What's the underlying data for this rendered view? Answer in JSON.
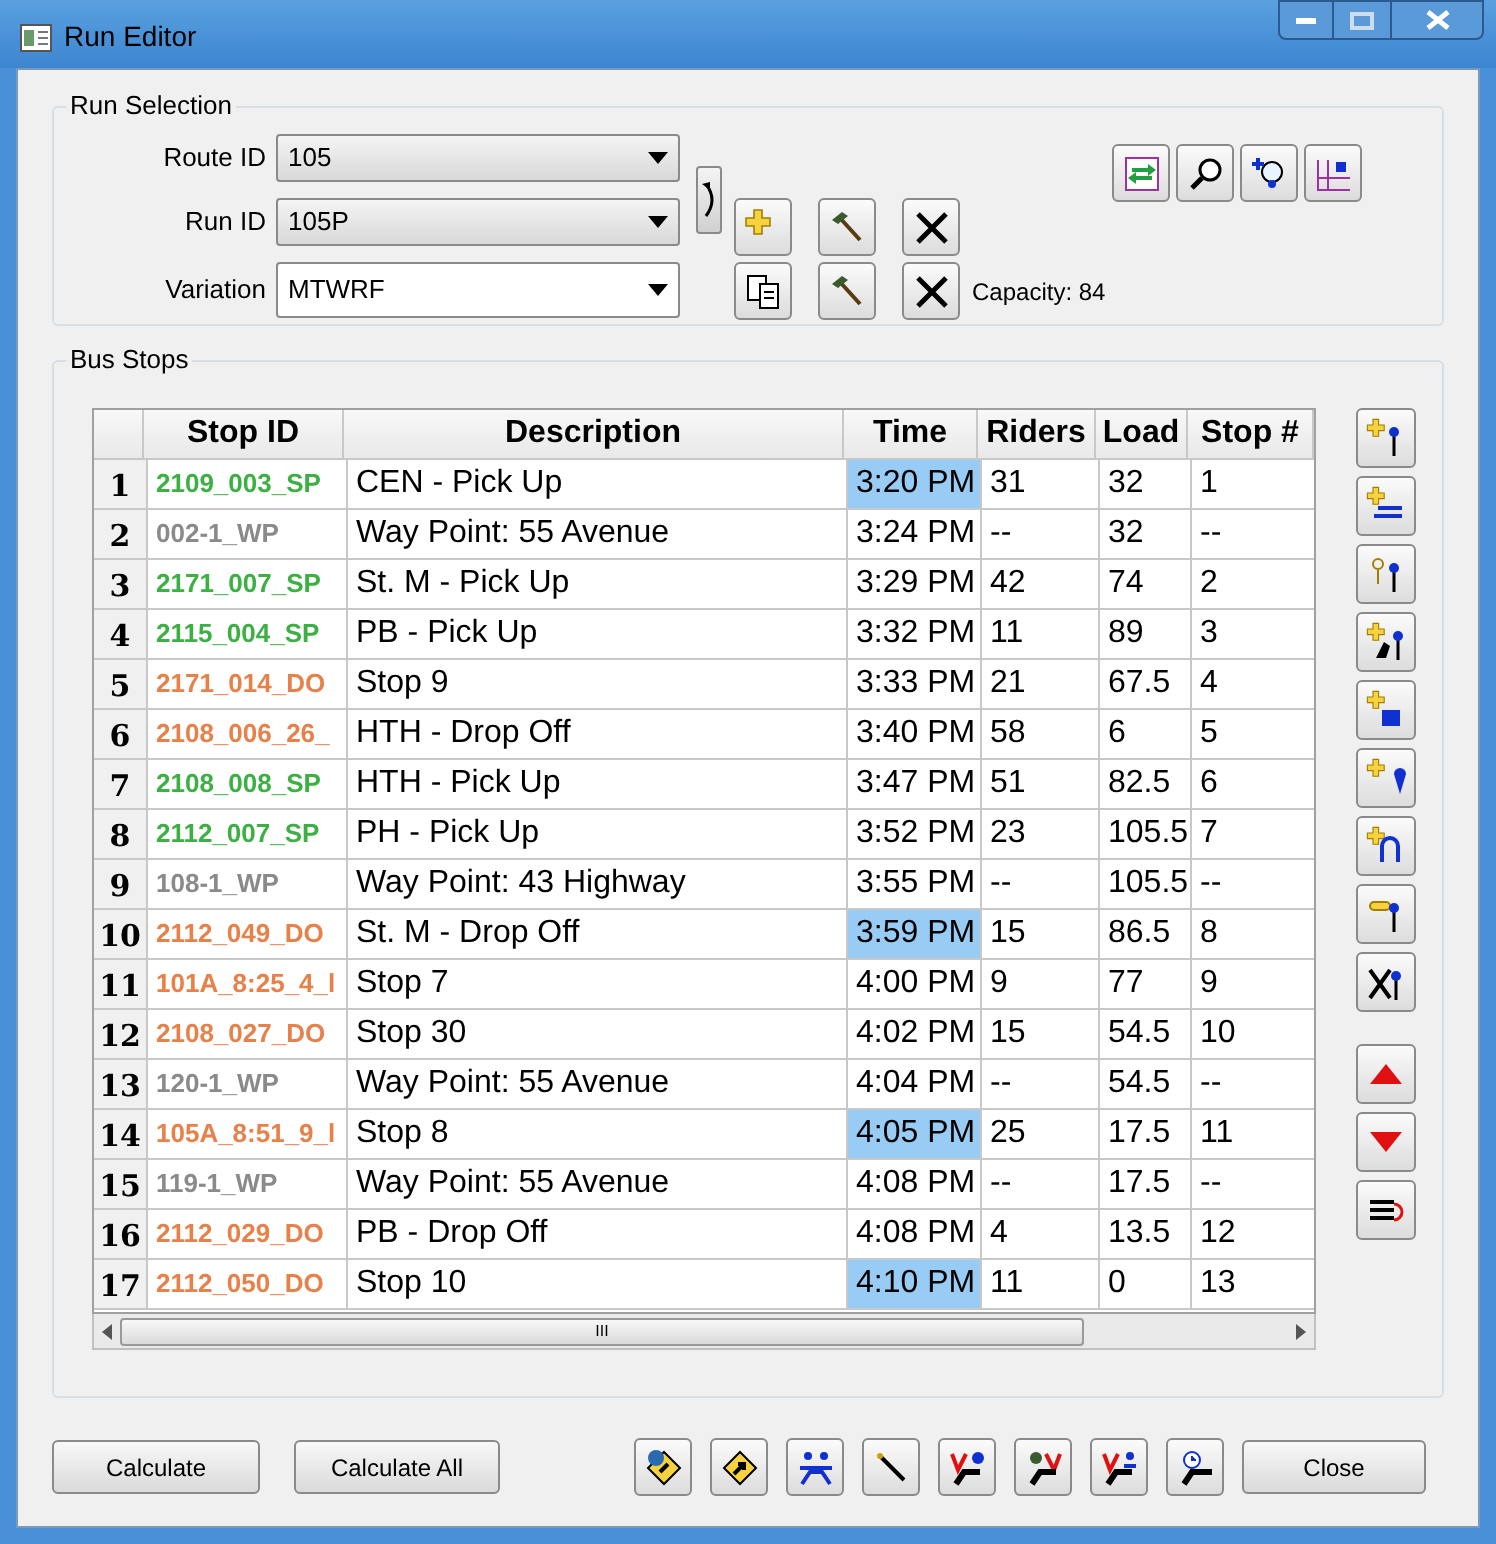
{
  "window": {
    "title": "Run Editor"
  },
  "run_selection": {
    "title": "Run Selection",
    "route_id": {
      "label": "Route ID",
      "value": "105"
    },
    "run_id": {
      "label": "Run ID",
      "value": "105P"
    },
    "variation": {
      "label": "Variation",
      "value": "MTWRF"
    },
    "capacity": "Capacity: 84"
  },
  "bus_stops": {
    "title": "Bus Stops",
    "table": {
      "columns": [
        "Stop ID",
        "Description",
        "Time",
        "Riders",
        "Load",
        "Stop #"
      ],
      "rows": [
        {
          "number": "1",
          "stop_id": "2109_003_SP",
          "kind": "pickup",
          "description": "CEN - Pick Up",
          "time": "3:20 PM",
          "selected": true,
          "riders": "31",
          "load": "32",
          "stop_no": "1"
        },
        {
          "number": "2",
          "stop_id": "002-1_WP",
          "kind": "waypoint",
          "description": "Way Point: 55 Avenue",
          "time": "3:24 PM",
          "selected": false,
          "riders": "--",
          "load": "32",
          "stop_no": "--"
        },
        {
          "number": "3",
          "stop_id": "2171_007_SP",
          "kind": "pickup",
          "description": "St. M - Pick Up",
          "time": "3:29 PM",
          "selected": false,
          "riders": "42",
          "load": "74",
          "stop_no": "2"
        },
        {
          "number": "4",
          "stop_id": "2115_004_SP",
          "kind": "pickup",
          "description": "PB - Pick Up",
          "time": "3:32 PM",
          "selected": false,
          "riders": "11",
          "load": "89",
          "stop_no": "3"
        },
        {
          "number": "5",
          "stop_id": "2171_014_DO",
          "kind": "dropoff",
          "description": "Stop 9",
          "time": "3:33 PM",
          "selected": false,
          "riders": "21",
          "load": "67.5",
          "stop_no": "4"
        },
        {
          "number": "6",
          "stop_id": "2108_006_26_",
          "kind": "dropoff",
          "description": "HTH - Drop Off",
          "time": "3:40 PM",
          "selected": false,
          "riders": "58",
          "load": "6",
          "stop_no": "5"
        },
        {
          "number": "7",
          "stop_id": "2108_008_SP",
          "kind": "pickup",
          "description": "HTH - Pick Up",
          "time": "3:47 PM",
          "selected": false,
          "riders": "51",
          "load": "82.5",
          "stop_no": "6"
        },
        {
          "number": "8",
          "stop_id": "2112_007_SP",
          "kind": "pickup",
          "description": "PH - Pick Up",
          "time": "3:52 PM",
          "selected": false,
          "riders": "23",
          "load": "105.5",
          "stop_no": "7"
        },
        {
          "number": "9",
          "stop_id": "108-1_WP",
          "kind": "waypoint",
          "description": "Way Point: 43 Highway",
          "time": "3:55 PM",
          "selected": false,
          "riders": "--",
          "load": "105.5",
          "stop_no": "--"
        },
        {
          "number": "10",
          "stop_id": "2112_049_DO",
          "kind": "dropoff",
          "description": "St. M - Drop Off",
          "time": "3:59 PM",
          "selected": true,
          "riders": "15",
          "load": "86.5",
          "stop_no": "8"
        },
        {
          "number": "11",
          "stop_id": "101A_8:25_4_l",
          "kind": "dropoff",
          "description": "Stop 7",
          "time": "4:00 PM",
          "selected": false,
          "riders": "9",
          "load": "77",
          "stop_no": "9"
        },
        {
          "number": "12",
          "stop_id": "2108_027_DO",
          "kind": "dropoff",
          "description": "Stop 30",
          "time": "4:02 PM",
          "selected": false,
          "riders": "15",
          "load": "54.5",
          "stop_no": "10"
        },
        {
          "number": "13",
          "stop_id": "120-1_WP",
          "kind": "waypoint",
          "description": "Way Point: 55 Avenue",
          "time": "4:04 PM",
          "selected": false,
          "riders": "--",
          "load": "54.5",
          "stop_no": "--"
        },
        {
          "number": "14",
          "stop_id": "105A_8:51_9_l",
          "kind": "dropoff",
          "description": "Stop 8",
          "time": "4:05 PM",
          "selected": true,
          "riders": "25",
          "load": "17.5",
          "stop_no": "11"
        },
        {
          "number": "15",
          "stop_id": "119-1_WP",
          "kind": "waypoint",
          "description": "Way Point: 55 Avenue",
          "time": "4:08 PM",
          "selected": false,
          "riders": "--",
          "load": "17.5",
          "stop_no": "--"
        },
        {
          "number": "16",
          "stop_id": "2112_029_DO",
          "kind": "dropoff",
          "description": "PB - Drop Off",
          "time": "4:08 PM",
          "selected": false,
          "riders": "4",
          "load": "13.5",
          "stop_no": "12"
        },
        {
          "number": "17",
          "stop_id": "2112_050_DO",
          "kind": "dropoff",
          "description": "Stop 10",
          "time": "4:10 PM",
          "selected": true,
          "riders": "11",
          "load": "0",
          "stop_no": "13"
        }
      ],
      "scrollbar_grip": "III"
    }
  },
  "buttons": {
    "calculate": "Calculate",
    "calculate_all": "Calculate All",
    "close": "Close"
  }
}
